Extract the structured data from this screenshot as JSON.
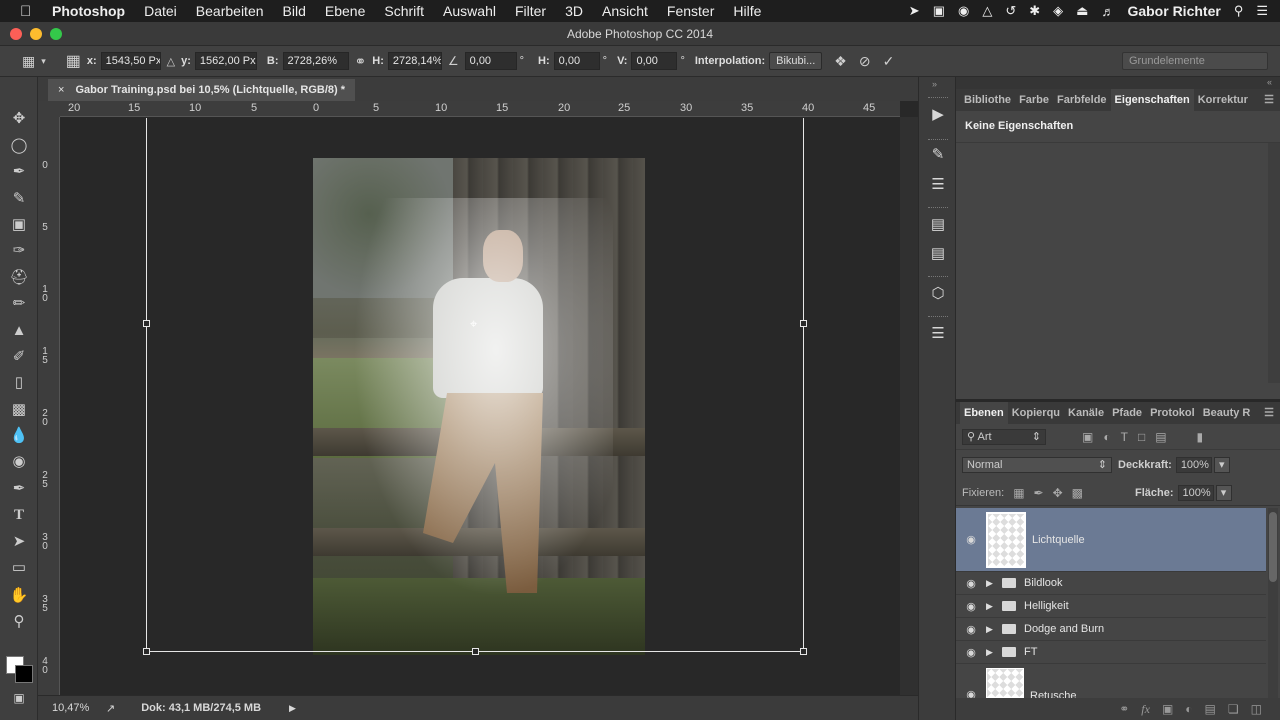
{
  "menubar": {
    "app_name": "Photoshop",
    "items": [
      "Datei",
      "Bearbeiten",
      "Bild",
      "Ebene",
      "Schrift",
      "Auswahl",
      "Filter",
      "3D",
      "Ansicht",
      "Fenster",
      "Hilfe"
    ],
    "user": "Gabor Richter"
  },
  "window": {
    "title": "Adobe Photoshop CC 2014"
  },
  "options": {
    "x_label": "x:",
    "x_value": "1543,50 Px",
    "y_label": "y:",
    "y_value": "1562,00 Px",
    "w_label": "B:",
    "w_value": "2728,26%",
    "h_label": "H:",
    "h_value": "2728,14%",
    "angle_value": "0,00",
    "angle_unit": "°",
    "hskew_label": "H:",
    "hskew_value": "0,00",
    "hskew_unit": "°",
    "vskew_label": "V:",
    "vskew_value": "0,00",
    "vskew_unit": "°",
    "interpolation_label": "Interpolation:",
    "interpolation_value": "Bikubi...",
    "workspace": "Grundelemente"
  },
  "document": {
    "tab_title": "Gabor Training.psd bei 10,5% (Lichtquelle, RGB/8) *",
    "ruler_top": [
      "20",
      "15",
      "10",
      "5",
      "0",
      "5",
      "10",
      "15",
      "20",
      "25",
      "30",
      "35",
      "40",
      "45"
    ],
    "ruler_left": [
      "0",
      "5",
      "10",
      "15",
      "20",
      "25",
      "30",
      "35",
      "40"
    ]
  },
  "status": {
    "zoom": "10,47%",
    "doc_info": "Dok: 43,1 MB/274,5 MB"
  },
  "properties_panel": {
    "tabs": [
      "Bibliothe",
      "Farbe",
      "Farbfelde",
      "Eigenschaften",
      "Korrektur"
    ],
    "active_tab": "Eigenschaften",
    "title": "Keine Eigenschaften"
  },
  "layers_panel": {
    "tabs": [
      "Ebenen",
      "Kopierqu",
      "Kanäle",
      "Pfade",
      "Protokol",
      "Beauty R"
    ],
    "filter_kind": "Art",
    "blend_mode": "Normal",
    "opacity_label": "Deckkraft:",
    "opacity_value": "100%",
    "lock_label": "Fixieren:",
    "fill_label": "Fläche:",
    "fill_value": "100%",
    "layers": [
      {
        "name": "Lichtquelle",
        "kind": "layer",
        "selected": true
      },
      {
        "name": "Bildlook",
        "kind": "group"
      },
      {
        "name": "Helligkeit",
        "kind": "group"
      },
      {
        "name": "Dodge and Burn",
        "kind": "group"
      },
      {
        "name": "FT",
        "kind": "group"
      },
      {
        "name": "Retusche",
        "kind": "layer"
      }
    ]
  },
  "colors": {
    "accent_selected": "#6b7a94",
    "foreground": "#ffffff",
    "background": "#000000"
  }
}
